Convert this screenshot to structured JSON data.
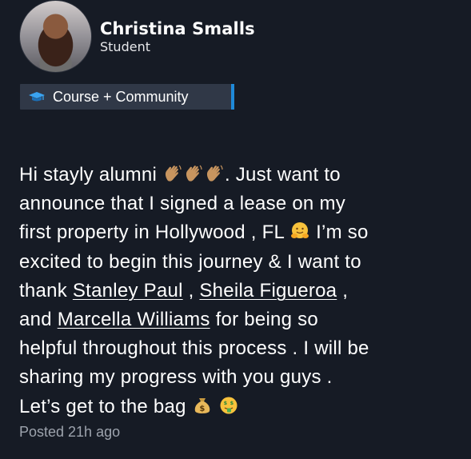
{
  "author": {
    "name": "Christina Smalls",
    "role": "Student"
  },
  "tag": {
    "icon": "graduation-cap-icon",
    "label": "Course + Community",
    "accent_color": "#1f8ad9"
  },
  "post": {
    "line1_a": "Hi stayly alumni ",
    "line1_b": ". Just want to",
    "line2": "announce that I signed a lease on my",
    "line3_a": "first property in Hollywood , FL ",
    "line3_b": " I’m so",
    "line4": "excited to begin this journey & I want to",
    "line5_a": "thank ",
    "mention1": "Stanley Paul",
    "line5_b": " , ",
    "mention2": "Sheila Figueroa",
    "line5_c": " ,",
    "line6_a": "and ",
    "mention3": "Marcella Williams",
    "line6_b": " for being so",
    "line7": "helpful throughout this process . I will be",
    "line8": "sharing my progress with you guys .",
    "line9": "Let’s get to the bag ",
    "emoji_names": [
      "waving-hand-icon",
      "waving-hand-icon",
      "waving-hand-icon",
      "hugging-face-icon",
      "money-bag-icon",
      "money-mouth-face-icon"
    ]
  },
  "meta": {
    "posted": "Posted 21h ago"
  },
  "colors": {
    "background": "#161b25",
    "tag_bg": "#303847",
    "muted_text": "#9da3ad"
  }
}
